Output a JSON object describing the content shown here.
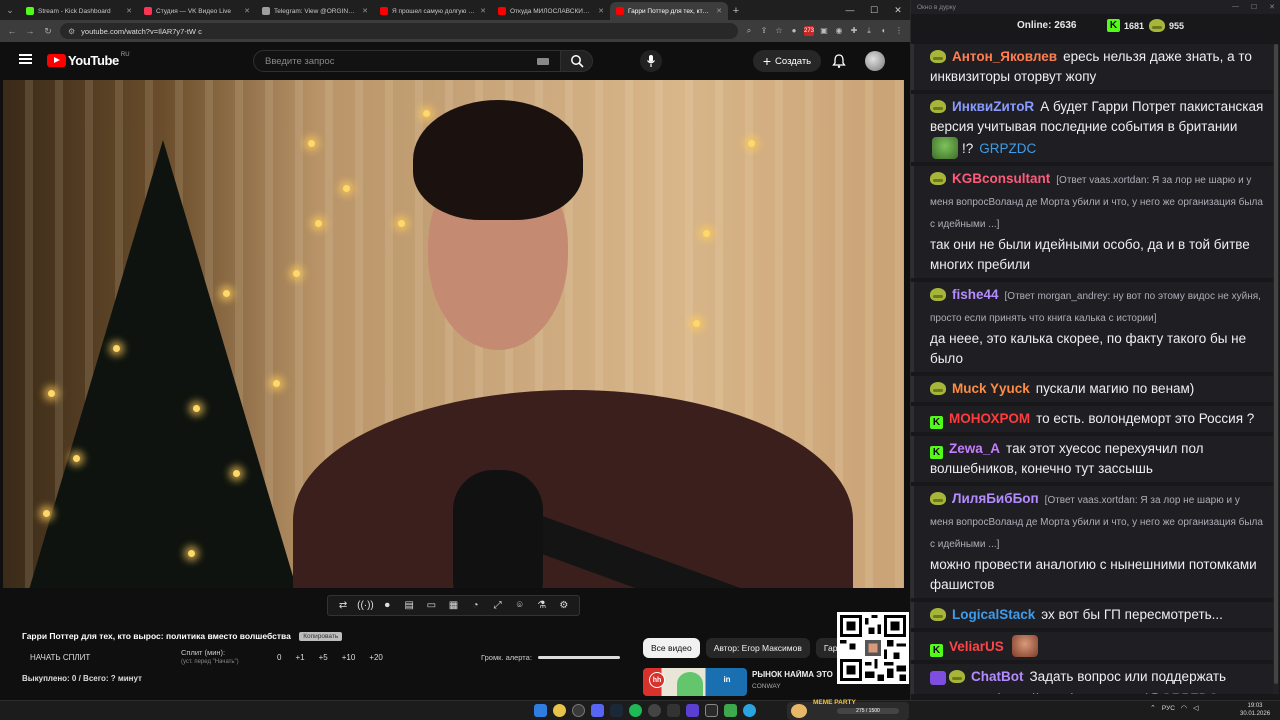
{
  "browser": {
    "tabs": [
      {
        "label": "Stream - Kick Dashboard",
        "color": "#53fc18"
      },
      {
        "label": "Студия — VK Видео Live",
        "color": "#ff3355"
      },
      {
        "label": "Telegram: View @ORGINALDA",
        "color": "#9e9e9e"
      },
      {
        "label": "Я прошел самую долгую войн",
        "color": "#ff0000"
      },
      {
        "label": "Откуда МИЛОСЛАВСКИЙ во",
        "color": "#ff0000"
      },
      {
        "label": "Гарри Поттер для тех, кто выр",
        "color": "#ff0000"
      }
    ],
    "url": "youtube.com/watch?v=IlAR7y7-tW c",
    "extension_badge": "273"
  },
  "youtube": {
    "logo_text": "YouTube",
    "region": "RU",
    "search_placeholder": "Введите запрос",
    "create_label": "Создать"
  },
  "stream_panel": {
    "video_title": "Гарри Поттер для тех, кто вырос: политика вместо волшебства",
    "title_badge": "Копировать",
    "start_split": "НАЧАТЬ СПЛИТ",
    "split_min_label": "Сплит (мин):",
    "split_min_hint": "(уст. перед \"Начать\")",
    "split_values": [
      "0",
      "+1",
      "+5",
      "+10",
      "+20"
    ],
    "alert_volume_label": "Громк. алерта:",
    "bought": "Выкуплено: 0 / Всего: ? минут"
  },
  "chips": [
    "Все видео",
    "Автор: Егор Максимов",
    "Гарри"
  ],
  "recommendation": {
    "title": "РЫНОК НАЙМА ЭТО",
    "channel": "CONWAY"
  },
  "chat": {
    "window_title": "Окно в дурку",
    "online_label": "Online:",
    "online_count": "2636",
    "kick_count": "1681",
    "yt_count": "955",
    "messages": [
      {
        "user": "Антон_Яковлев",
        "color": "#ff7f50",
        "platform": "yt",
        "text": "ересь нельзя даже знать, а то инквизиторы оторвут жопу"
      },
      {
        "user": "ИнквиZитоR",
        "color": "#8a9bff",
        "platform": "yt",
        "text": "А будет Гарри Потрет пакистанская версия учитывая последние события в британии",
        "emote": "frog",
        "after": "!?",
        "mention": "GRPZDC"
      },
      {
        "user": "KGBconsultant",
        "color": "#ff5a7a",
        "platform": "yt",
        "reply": "[Ответ vaas.xortdan: Я за лор не шарю и у меня вопросВоланд де Морта  убили и что, у него же организация была с идейными ...]",
        "text": "так они не были идейными особо, да и в той битве многих пребили"
      },
      {
        "user": "fishe44",
        "color": "#b48cff",
        "platform": "yt",
        "reply": "[Ответ morgan_andrey: ну вот по этому видос не хуйня, просто если принять что книга калька с истории]",
        "text": "да неее, это калька скорее, по факту такого бы не было"
      },
      {
        "user": "Muck Yyuck",
        "color": "#ff8c42",
        "platform": "yt",
        "text": "пускали магию по венам)"
      },
      {
        "user": "МОНОХРОМ",
        "color": "#ff3b3b",
        "platform": "kick",
        "text": "то есть. волондеморт это Россия ?"
      },
      {
        "user": "Zewa_A",
        "color": "#c77dff",
        "platform": "kick",
        "text": "так этот хуесос перехуячил пол волшебников, конечно тут зассышь"
      },
      {
        "user": "ЛиляБибБоп",
        "color": "#b48cff",
        "platform": "yt",
        "reply": "[Ответ vaas.xortdan: Я за лор не шарю и у меня вопросВоланд де Морта  убили и что, у него же организация была с идейными ...]",
        "text": "можно провести аналогию с нынешними потомками фашистов"
      },
      {
        "user": "LogicalStack",
        "color": "#3f9ce8",
        "platform": "yt",
        "text": "эх вот бы ГП пересмотреть..."
      },
      {
        "user": "VeliarUS",
        "color": "#ff4545",
        "platform": "kick",
        "text": "",
        "emote": "face"
      },
      {
        "user": "ChatBot",
        "color": "#b48cff",
        "platform": "bot",
        "text": "Задать вопрос или поддержать стримера:",
        "link": "https://new.donatepay.ru/@GRPZDC"
      }
    ]
  },
  "taskbar": {
    "meme_title": "MEME PARTY",
    "meme_progress": "275 / 1500",
    "language": "РУС",
    "time": "19:03",
    "date": "30.01.2026"
  }
}
